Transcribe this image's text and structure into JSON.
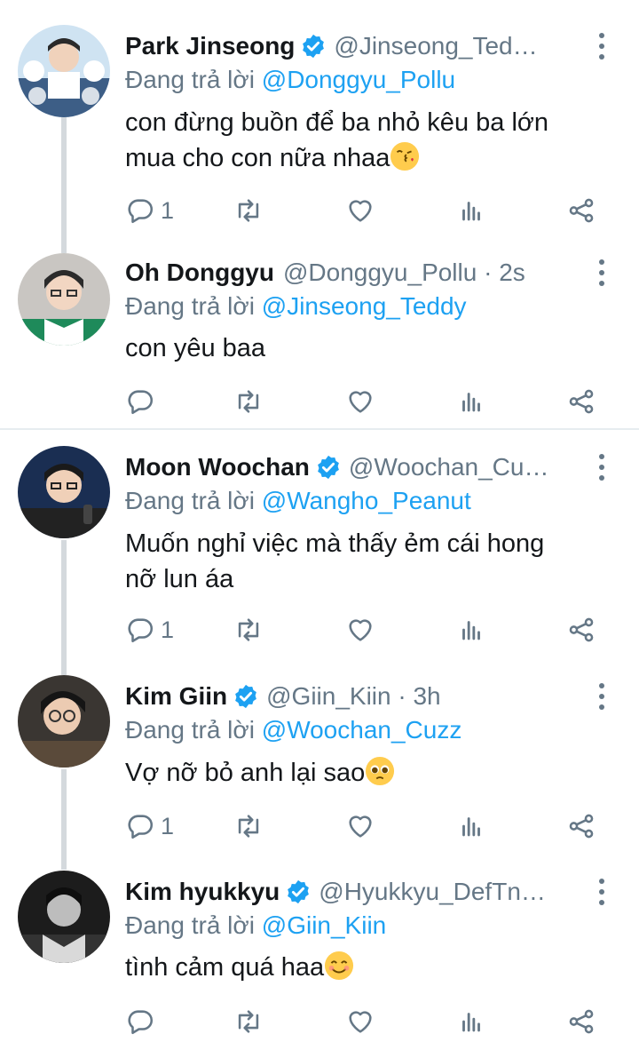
{
  "replying_prefix": "Đang trả lời ",
  "tweets": [
    {
      "name": "Park Jinseong",
      "verified": true,
      "handle": "@Jinseong_Ted…",
      "replying_to": "@Donggyu_Pollu",
      "text_lines": [
        "con đừng buồn để ba nhỏ kêu ba lớn",
        "mua cho con nữa nhaa"
      ],
      "emoji": "face-blowing-kiss",
      "reply_count": "1"
    },
    {
      "name": "Oh Donggyu",
      "verified": false,
      "handle": "@Donggyu_Pollu · 2s",
      "replying_to": "@Jinseong_Teddy",
      "text_lines": [
        "con yêu baa"
      ],
      "emoji": "",
      "reply_count": ""
    },
    {
      "name": "Moon Woochan",
      "verified": true,
      "handle": "@Woochan_Cu…",
      "replying_to": "@Wangho_Peanut",
      "text_lines": [
        "Muốn nghỉ việc mà thấy ẻm cái hong",
        "nỡ lun áa"
      ],
      "emoji": "",
      "reply_count": "1"
    },
    {
      "name": "Kim Giin",
      "verified": true,
      "handle": "@Giin_Kiin · 3h",
      "replying_to": "@Woochan_Cuzz",
      "text_lines": [
        "Vợ nỡ bỏ anh lại sao"
      ],
      "emoji": "pleading-face",
      "reply_count": "1"
    },
    {
      "name": "Kim hyukkyu",
      "verified": true,
      "handle": "@Hyukkyu_DefTn…",
      "replying_to": "@Giin_Kiin",
      "text_lines": [
        "tình cảm quá haa"
      ],
      "emoji": "smiling-face",
      "reply_count": ""
    }
  ],
  "colors": {
    "text": "#14171a",
    "secondary": "#657786",
    "link": "#1da1f2",
    "thread_line": "#d4d9dd",
    "divider": "#e6ecf0"
  },
  "icons": [
    "reply-icon",
    "retweet-icon",
    "like-icon",
    "analytics-icon",
    "share-icon",
    "more-icon",
    "verified-badge-icon"
  ]
}
